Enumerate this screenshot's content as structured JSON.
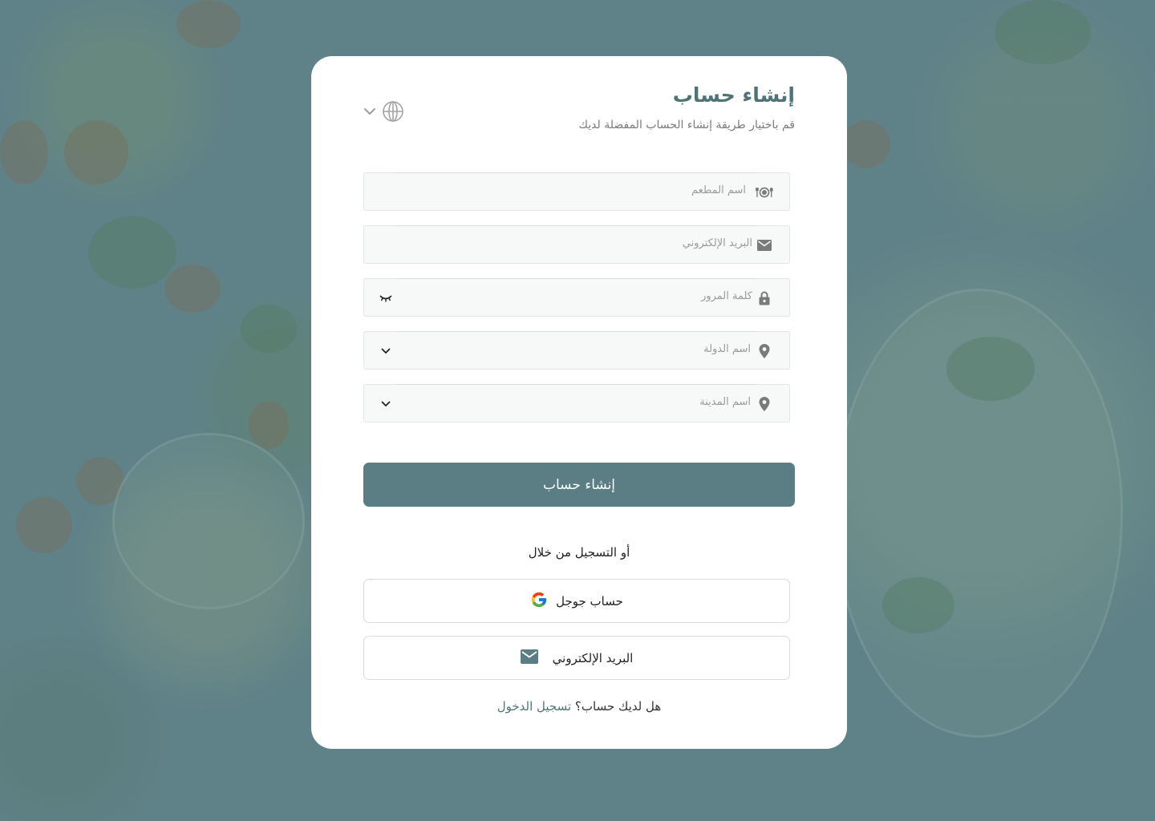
{
  "header": {
    "title": "إنشاء حساب",
    "subtitle": "قم باختيار طريقة إنشاء الحساب المفضلة لديك"
  },
  "form": {
    "restaurant_placeholder": "اسم المطعم",
    "email_placeholder": "البريد الإلكتروني",
    "password_placeholder": "كلمة المرور",
    "country_placeholder": "اسم الدولة",
    "city_placeholder": "اسم المدينة",
    "submit_label": "إنشاء حساب"
  },
  "social": {
    "divider_text": "أو التسجيل من خلال",
    "google_label": "حساب جوجل",
    "email_label": "البريد الإلكتروني"
  },
  "footer": {
    "question": "هل لديك حساب؟",
    "signin_link": "تسجيل الدخول"
  },
  "colors": {
    "accent": "#5a7e83",
    "title": "#4f7377",
    "background": "#5f8288"
  },
  "icons": {
    "language": "globe-icon",
    "restaurant": "dining-icon",
    "email": "mail-icon",
    "password": "lock-icon",
    "location": "location-pin-icon",
    "toggle_password": "eye-closed-icon",
    "dropdown": "chevron-down-icon",
    "google": "google-icon"
  }
}
